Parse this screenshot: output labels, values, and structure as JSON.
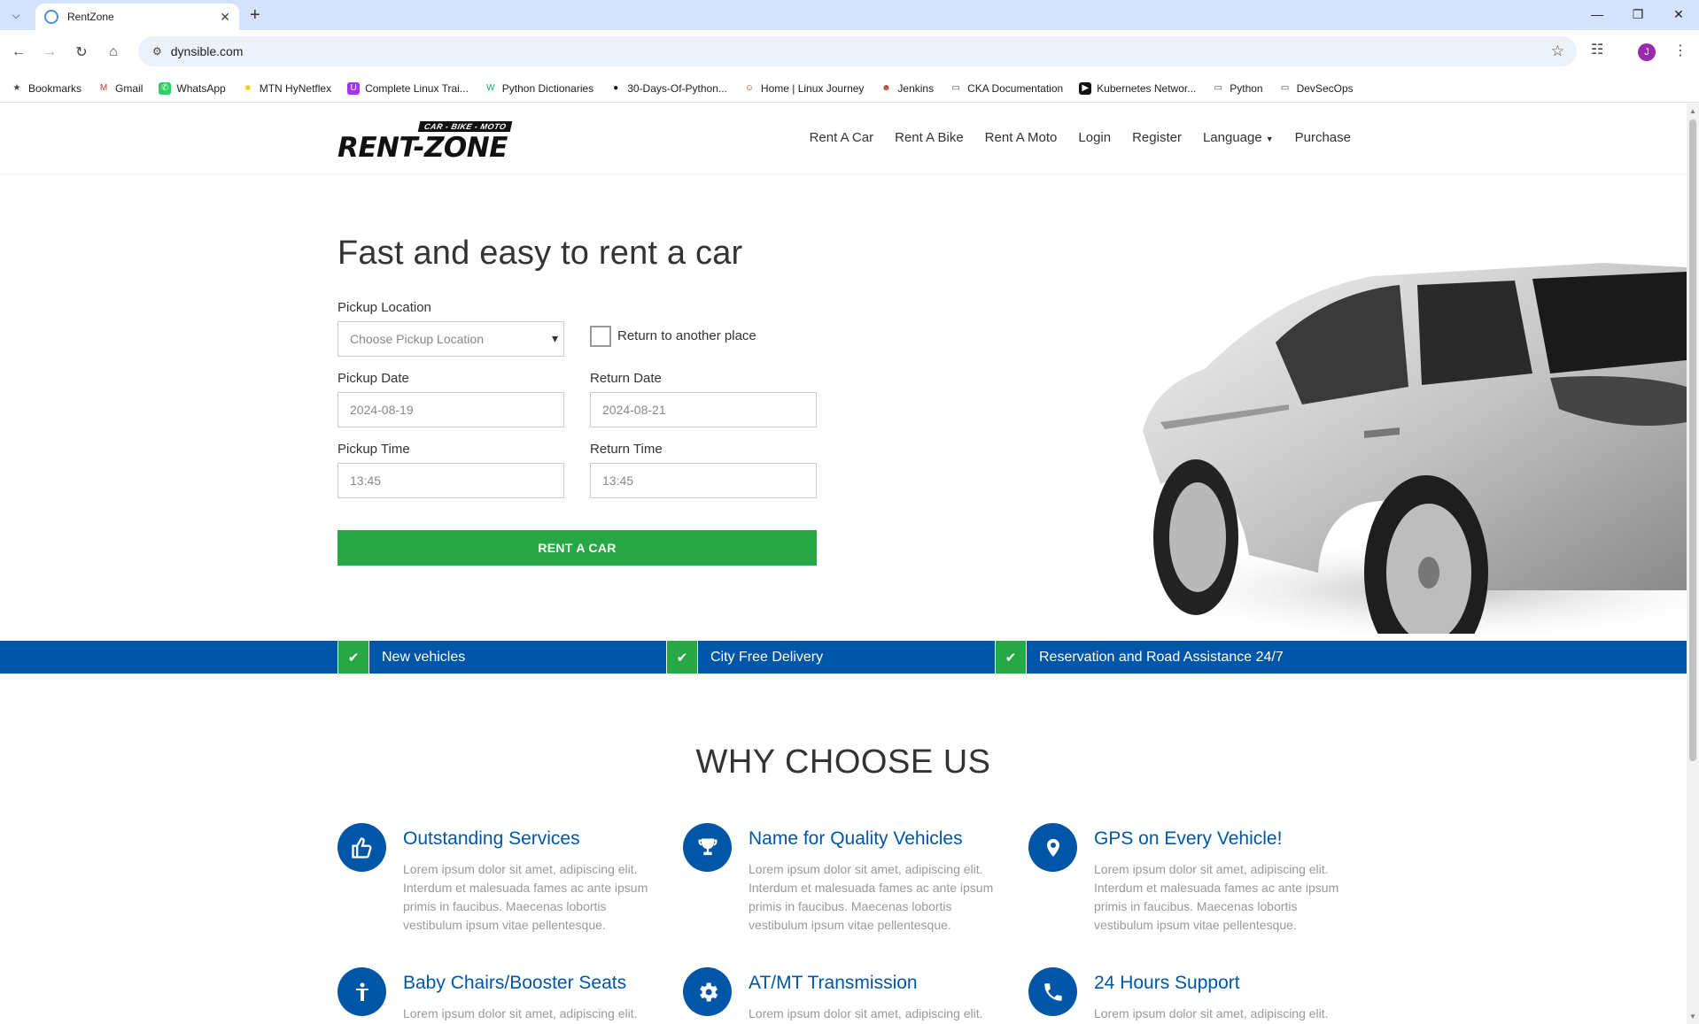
{
  "browser": {
    "tab_title": "RentZone",
    "url": "dynsible.com",
    "profile_initial": "J",
    "bookmarks": [
      {
        "label": "Bookmarks",
        "icon": "star-icon"
      },
      {
        "label": "Gmail",
        "icon": "gmail-icon"
      },
      {
        "label": "WhatsApp",
        "icon": "whatsapp-icon"
      },
      {
        "label": "MTN HyNetflex",
        "icon": "mtn-icon"
      },
      {
        "label": "Complete Linux Trai...",
        "icon": "udemy-icon"
      },
      {
        "label": "Python Dictionaries",
        "icon": "w3-icon"
      },
      {
        "label": "30-Days-Of-Python...",
        "icon": "github-icon"
      },
      {
        "label": "Home | Linux Journey",
        "icon": "linux-journey-icon"
      },
      {
        "label": "Jenkins",
        "icon": "jenkins-icon"
      },
      {
        "label": "CKA Documentation",
        "icon": "folder-icon"
      },
      {
        "label": "Kubernetes Networ...",
        "icon": "video-icon"
      },
      {
        "label": "Python",
        "icon": "folder-icon"
      },
      {
        "label": "DevSecOps",
        "icon": "folder-icon"
      }
    ]
  },
  "site": {
    "logo": {
      "tagline": "CAR - BIKE - MOTO",
      "wordmark": "RENT-ZONE"
    },
    "nav": [
      "Rent A Car",
      "Rent A Bike",
      "Rent A Moto",
      "Login",
      "Register",
      "Language",
      "Purchase"
    ],
    "hero": {
      "title": "Fast and easy to rent a car",
      "pickup_location_label": "Pickup Location",
      "pickup_location_value": "Choose Pickup Location",
      "return_other_label": "Return to another place",
      "pickup_date_label": "Pickup Date",
      "pickup_date_value": "2024-08-19",
      "return_date_label": "Return Date",
      "return_date_value": "2024-08-21",
      "pickup_time_label": "Pickup Time",
      "pickup_time_value": "13:45",
      "return_time_label": "Return Time",
      "return_time_value": "13:45",
      "submit_label": "RENT A CAR"
    },
    "features": [
      "New vehicles",
      "City Free Delivery",
      "Reservation and Road Assistance 24/7"
    ],
    "why_title": "WHY CHOOSE US",
    "services": [
      {
        "title": "Outstanding Services",
        "icon": "thumbs-up-icon",
        "desc": "Lorem ipsum dolor sit amet, adipiscing elit. Interdum et malesuada fames ac ante ipsum primis in faucibus. Maecenas lobortis vestibulum ipsum vitae pellentesque."
      },
      {
        "title": "Name for Quality Vehicles",
        "icon": "trophy-icon",
        "desc": "Lorem ipsum dolor sit amet, adipiscing elit. Interdum et malesuada fames ac ante ipsum primis in faucibus. Maecenas lobortis vestibulum ipsum vitae pellentesque."
      },
      {
        "title": "GPS on Every Vehicle!",
        "icon": "map-pin-icon",
        "desc": "Lorem ipsum dolor sit amet, adipiscing elit. Interdum et malesuada fames ac ante ipsum primis in faucibus. Maecenas lobortis vestibulum ipsum vitae pellentesque."
      },
      {
        "title": "Baby Chairs/Booster Seats",
        "icon": "child-icon",
        "desc": "Lorem ipsum dolor sit amet, adipiscing elit."
      },
      {
        "title": "AT/MT Transmission",
        "icon": "gear-icon",
        "desc": "Lorem ipsum dolor sit amet, adipiscing elit."
      },
      {
        "title": "24 Hours Support",
        "icon": "phone-icon",
        "desc": "Lorem ipsum dolor sit amet, adipiscing elit."
      }
    ]
  },
  "colors": {
    "brand_blue": "#0056a6",
    "accent_green": "#28a745"
  }
}
